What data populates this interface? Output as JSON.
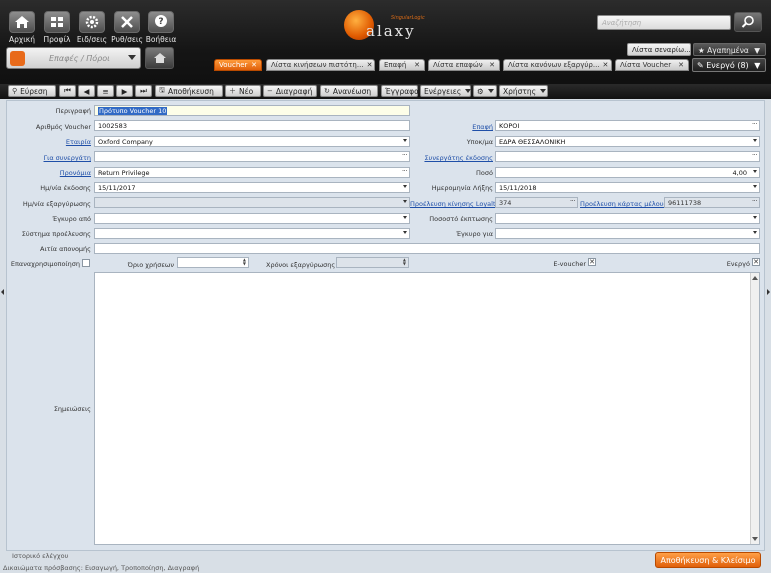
{
  "nav": {
    "home": "Αρχική",
    "profile": "Προφίλ",
    "notifications": "Ειδ/σεις",
    "settings": "Ρυθ/σεις",
    "help": "Βοήθεια"
  },
  "logo": {
    "brand": "SingularLogic",
    "word": "alaxy"
  },
  "search": {
    "placeholder": "Αναζήτηση"
  },
  "module": {
    "label": "Επαφές / Πόροι"
  },
  "scenarios_label": "Λίστα σεναρίω...",
  "favorites_label": "★ Αγαπημένα",
  "tabs": [
    {
      "label": "Voucher"
    },
    {
      "label": "Λίστα κινήσεων πιστότη..."
    },
    {
      "label": "Επαφή"
    },
    {
      "label": "Λίστα επαφών"
    },
    {
      "label": "Λίστα κανόνων εξαργύρ..."
    },
    {
      "label": "Λίστα Voucher"
    }
  ],
  "active_label": "Ενεργό (8)",
  "toolbar": {
    "find": "Εύρεση",
    "save": "Αποθήκευση",
    "new": "Νέο",
    "delete": "Διαγραφή",
    "refresh": "Ανανέωση",
    "documents": "Έγγραφα",
    "actions": "Ενέργειες",
    "user": "Χρήστης"
  },
  "form": {
    "description_label": "Περιγραφή",
    "description_value": "Πρότυπο Voucher 10",
    "voucher_no_label": "Αριθμός Voucher",
    "voucher_no_value": "1002583",
    "contact_label": "Επαφή",
    "contact_value": "ΚΟΡΟΙ",
    "company_label": "Εταιρία",
    "company_value": "Oxford Company",
    "branch_label": "Υποκ/μα",
    "branch_value": "ΕΔΡΑ ΘΕΣΣΑΛΟΝΙΚΗ",
    "partner_label": "Για συνεργάτη",
    "issuer_label": "Συνεργάτης έκδοσης",
    "privilege_label": "Προνόμια",
    "privilege_value": "Return Privilege",
    "amount_label": "Ποσό",
    "amount_value": "4,00",
    "issue_date_label": "Ημ/νία έκδοσης",
    "issue_date_value": "15/11/2017",
    "expiry_date_label": "Ημερομηνία Λήξης",
    "expiry_date_value": "15/11/2018",
    "redeem_date_label": "Ημ/νία εξαργύρωσης",
    "loyalty_origin_label": "Προέλευση κίνησης Loyalty",
    "loyalty_origin_value": "374",
    "card_origin_label": "Προέλευση κάρτας μέλους",
    "card_origin_value": "96111738",
    "valid_from_label": "Έγκυρο από",
    "discount_label": "Ποσοστό έκπτωσης",
    "origin_system_label": "Σύστημα προέλευσης",
    "valid_for_label": "Έγκυρο για",
    "cancel_reason_label": "Αιτία απονομής",
    "reusable_label": "Επαναχρησιμοποίηση",
    "usage_limit_label": "Όριο χρήσεων",
    "redeem_times_label": "Χρόνοι εξαργύρωσης",
    "evoucher_label": "E-voucher",
    "active_label": "Ενεργό",
    "notes_label": "Σημειώσεις"
  },
  "footer": {
    "audit": "Ιστορικό ελέγχου",
    "permissions": "Δικαιώματα πρόσβασης: Εισαγωγή, Τροποποίηση, Διαγραφή",
    "save_close": "Αποθήκευση & Κλείσιμο"
  },
  "colors": {
    "accent": "#e86a1a",
    "header": "#151515",
    "link": "#1f4fa8"
  }
}
